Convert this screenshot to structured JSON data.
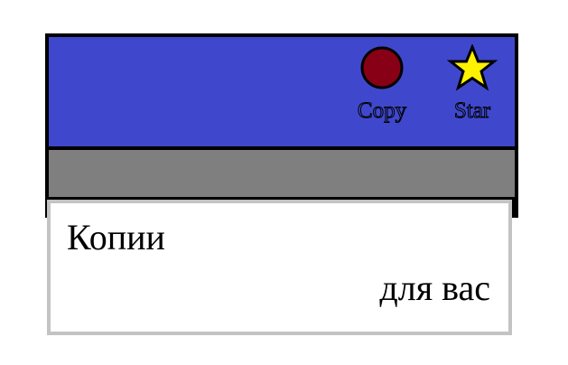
{
  "toolbar": {
    "buttons": [
      {
        "label": "Copy",
        "icon": "circle-icon",
        "color": "#880015"
      },
      {
        "label": "Star",
        "icon": "star-icon",
        "color": "#fff200"
      }
    ],
    "background": "#3f48cc"
  },
  "separator": {
    "color": "#7f7f7f"
  },
  "panel": {
    "title": "Копии",
    "subtitle": "для вас",
    "border_color": "#c3c3c3"
  }
}
